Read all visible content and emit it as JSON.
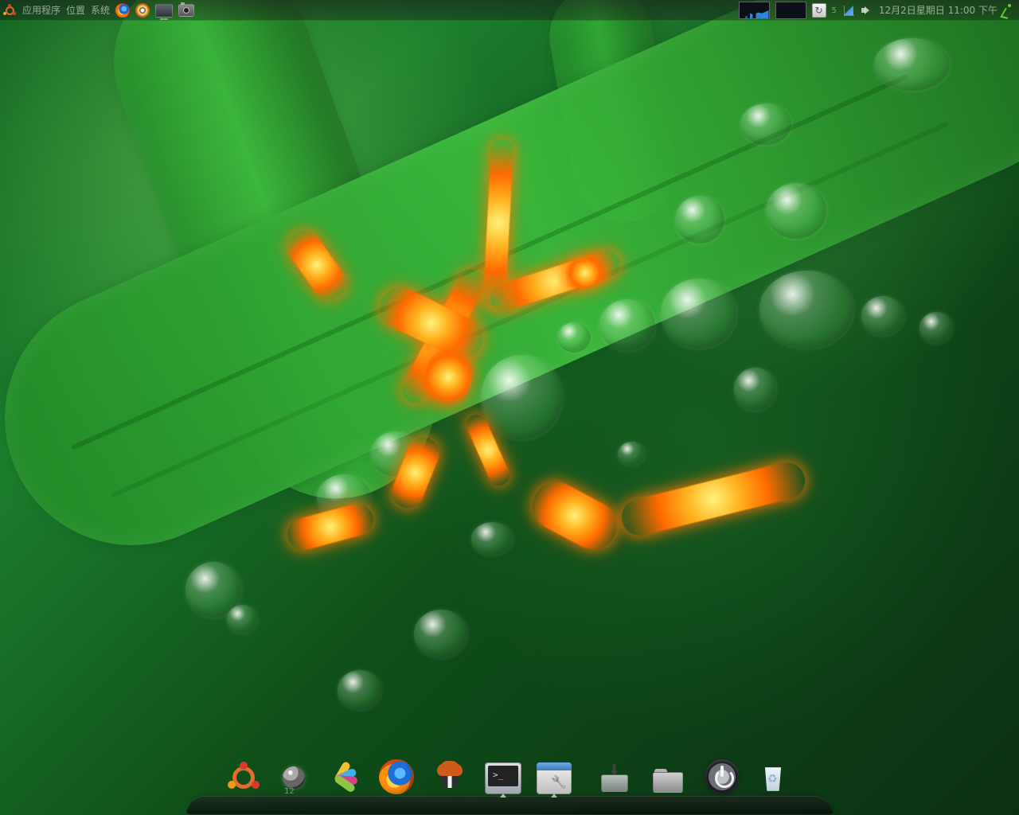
{
  "top_panel": {
    "menu": {
      "applications": "应用程序",
      "places": "位置",
      "system": "系统"
    },
    "launchers": [
      {
        "name": "firefox-icon"
      },
      {
        "name": "settings-icon"
      },
      {
        "name": "monitor-icon"
      },
      {
        "name": "camera-icon"
      }
    ],
    "workspace_count": "5",
    "clock": "12月2日星期日 11:00 下午"
  },
  "dock": {
    "orb_label": "12"
  },
  "colors": {
    "panel_bg": "#1a1a1a",
    "dock_bg": "#111111",
    "glow": "#ff7a00",
    "leaf": "#2e9a38"
  }
}
